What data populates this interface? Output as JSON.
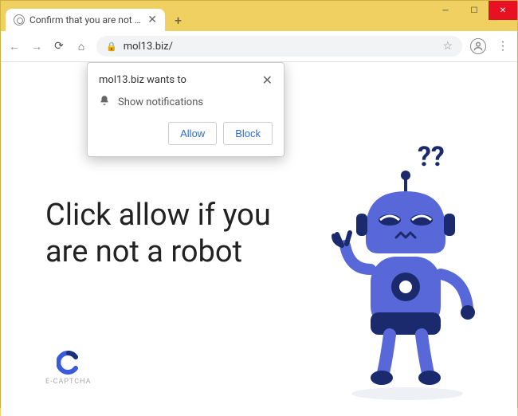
{
  "window": {
    "minimize": "─",
    "maximize": "☐",
    "close": "✕"
  },
  "tab": {
    "title": "Confirm that you are not a robot",
    "close": "✕"
  },
  "new_tab": "+",
  "nav": {
    "back": "←",
    "forward": "→",
    "reload": "⟳",
    "home": "⌂"
  },
  "address": {
    "lock": "🔒",
    "url": "mol13.biz/",
    "star": "☆"
  },
  "menu": "⋮",
  "permission": {
    "title": "mol13.biz wants to",
    "body": "Show notifications",
    "close": "✕",
    "allow": "Allow",
    "block": "Block"
  },
  "page": {
    "headline": "Click allow if you are not a robot",
    "captcha_label": "E-CAPTCHA",
    "question_marks": "??"
  }
}
